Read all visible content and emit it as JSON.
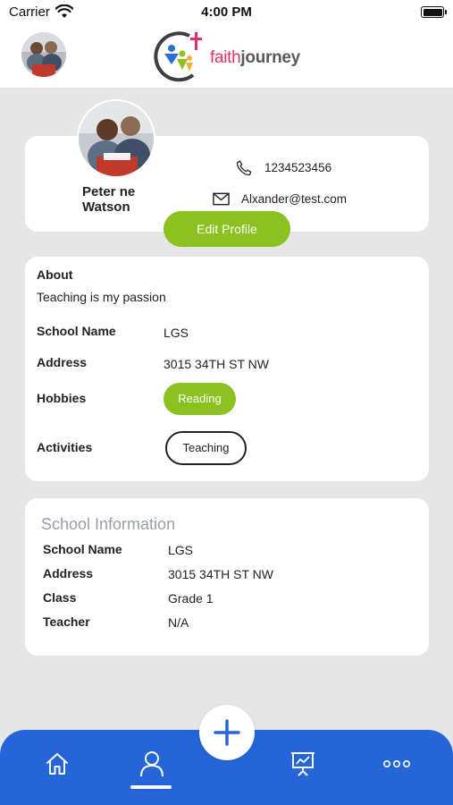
{
  "status_bar": {
    "carrier": "Carrier",
    "time": "4:00 PM"
  },
  "header": {
    "logo_faith": "faith",
    "logo_journey": "journey"
  },
  "profile": {
    "name_line1": "Peter ne",
    "name_line2": "Watson",
    "phone": "1234523456",
    "email": "Alxander@test.com",
    "edit_label": "Edit Profile"
  },
  "about": {
    "heading": "About",
    "text": "Teaching is my passion",
    "school_label": "School Name",
    "school_value": "LGS",
    "address_label": "Address",
    "address_value": "3015 34TH ST NW",
    "hobbies_label": "Hobbies",
    "hobby": "Reading",
    "activities_label": "Activities",
    "activity": "Teaching"
  },
  "school_info": {
    "title": "School Information",
    "rows": [
      {
        "label": "School Name",
        "value": "LGS"
      },
      {
        "label": "Address",
        "value": "3015 34TH ST NW"
      },
      {
        "label": "Class",
        "value": "Grade 1"
      },
      {
        "label": "Teacher",
        "value": "N/A"
      }
    ]
  },
  "nav": {
    "items": [
      "home-icon",
      "profile-icon",
      "presentation-icon",
      "more-icon"
    ],
    "active": "profile-icon",
    "fab_icon": "plus-icon"
  },
  "colors": {
    "accent_green": "#8bc21f",
    "nav_blue": "#2466d8",
    "logo_pink": "#e0306d"
  }
}
